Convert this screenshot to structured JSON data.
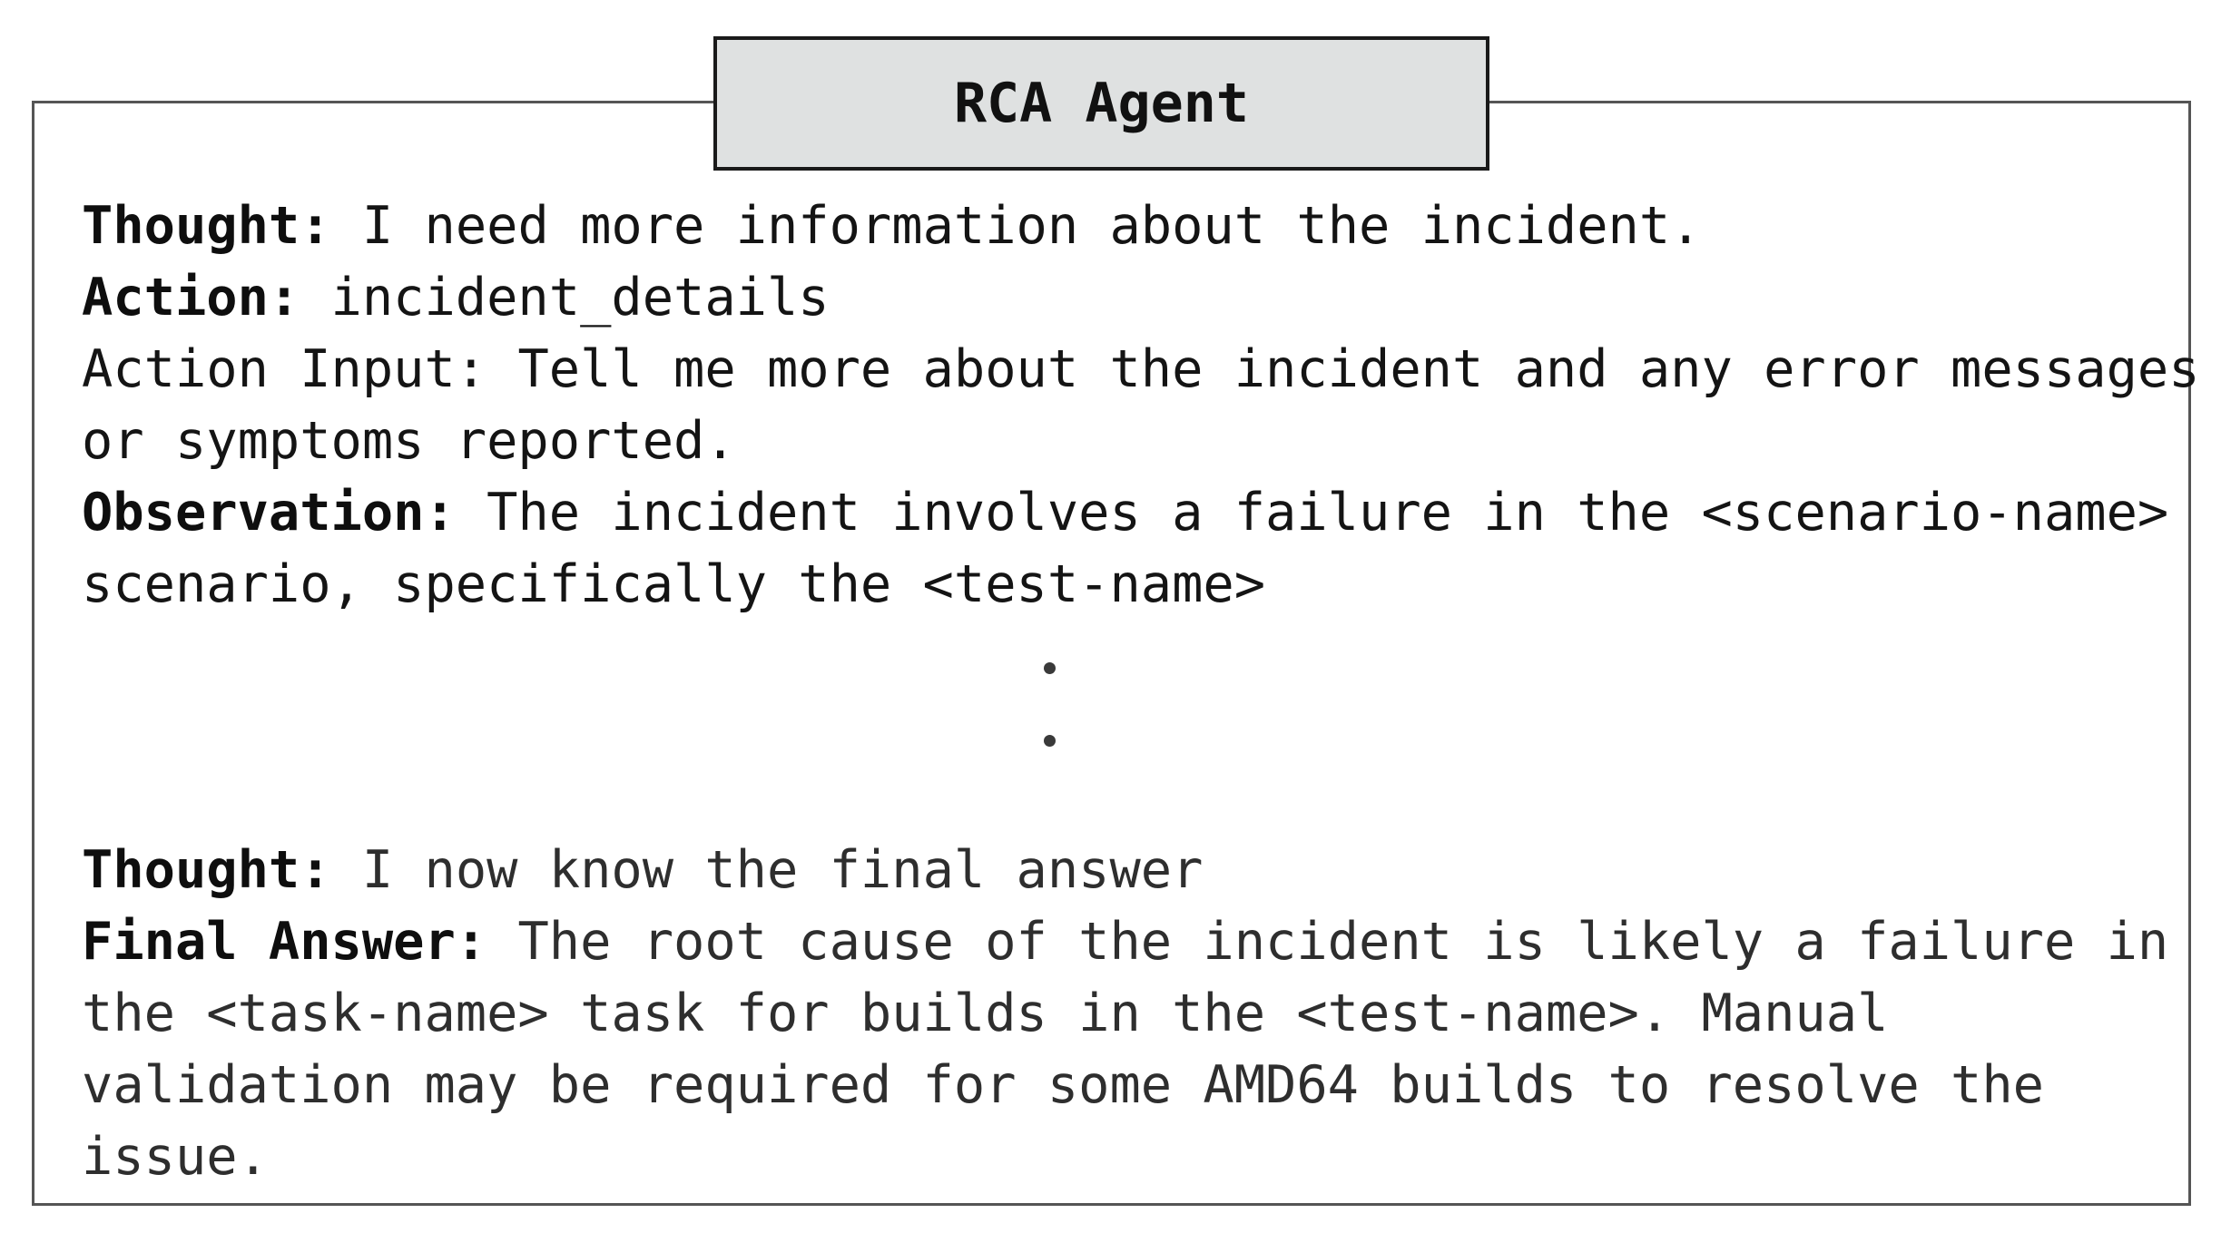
{
  "title": "RCA Agent",
  "steps": [
    {
      "thought_label": "Thought:",
      "thought": " I need more information about the incident.",
      "action_label": "Action:",
      "action": " incident_details",
      "action_input_label": "Action Input:",
      "action_input_line1": " Tell me more about the incident and any error messages",
      "action_input_line2": "or symptoms reported.",
      "observation_label": "Observation:",
      "observation_line1": " The incident involves a failure in the <scenario-name>",
      "observation_line2": "scenario, specifically the <test-name>"
    }
  ],
  "final": {
    "thought_label": "Thought:",
    "thought": " I now know the final answer",
    "answer_label": "Final Answer:",
    "answer_line1": " The root cause of the incident is likely a failure in",
    "answer_line2": "the <task-name> task for builds in the <test-name>. Manual",
    "answer_line3": "validation may be required for some AMD64 builds to resolve the",
    "answer_line4": "issue."
  }
}
